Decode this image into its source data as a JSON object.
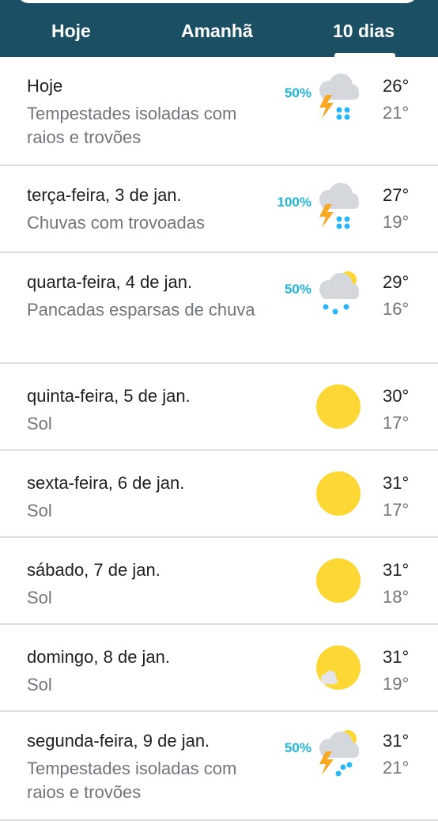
{
  "tabs": [
    {
      "label": "Hoje"
    },
    {
      "label": "Amanhã"
    },
    {
      "label": "10 dias",
      "selected": true
    }
  ],
  "colors": {
    "header_bg": "#1b5064",
    "precip_text": "#1fb5d6",
    "sun": "#fdd835",
    "cloud": "#d4d8dc",
    "bolt": "#f9a825",
    "rain": "#29b6f6"
  },
  "forecast": [
    {
      "date": "Hoje",
      "condition": "Tempestades isoladas com raios e trovões",
      "precip": "50%",
      "icon": "thunderstorm-icon",
      "high": "26°",
      "low": "21°"
    },
    {
      "date": "terça-feira, 3 de jan.",
      "condition": "Chuvas com trovoadas",
      "precip": "100%",
      "icon": "thunderstorm-icon",
      "high": "27°",
      "low": "19°"
    },
    {
      "date": "quarta-feira, 4 de jan.",
      "condition": "Pancadas esparsas de chuva",
      "precip": "50%",
      "icon": "scattered-showers-icon",
      "high": "29°",
      "low": "16°"
    },
    {
      "date": "quinta-feira, 5 de jan.",
      "condition": "Sol",
      "icon": "sun-icon",
      "high": "30°",
      "low": "17°"
    },
    {
      "date": "sexta-feira, 6 de jan.",
      "condition": "Sol",
      "icon": "sun-icon",
      "high": "31°",
      "low": "17°"
    },
    {
      "date": "sábado, 7 de jan.",
      "condition": "Sol",
      "icon": "sun-icon",
      "high": "31°",
      "low": "18°"
    },
    {
      "date": "domingo, 8 de jan.",
      "condition": "Sol",
      "icon": "mostly-sunny-icon",
      "high": "31°",
      "low": "19°"
    },
    {
      "date": "segunda-feira, 9 de jan.",
      "condition": "Tempestades isoladas com raios e trovões",
      "precip": "50%",
      "icon": "isolated-thunderstorm-icon",
      "high": "31°",
      "low": "21°"
    }
  ]
}
